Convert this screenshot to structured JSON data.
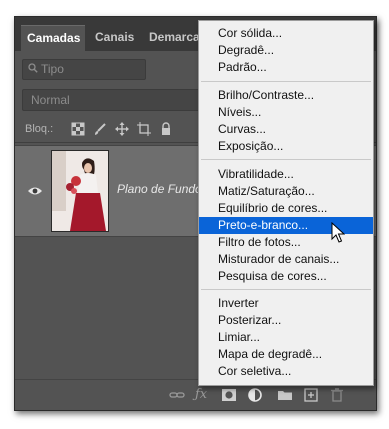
{
  "tabs": [
    {
      "label": "Camadas",
      "active": true
    },
    {
      "label": "Canais",
      "active": false
    },
    {
      "label": "Demarcadores",
      "active": false
    }
  ],
  "search": {
    "value": "Tipo",
    "icon": "search-icon"
  },
  "blend_mode": {
    "value": "Normal"
  },
  "lock": {
    "label": "Bloq.:"
  },
  "layer": {
    "name": "Plano de Fundo",
    "visible": true
  },
  "menu": {
    "groups": [
      [
        "Cor sólida...",
        "Degradê...",
        "Padrão..."
      ],
      [
        "Brilho/Contraste...",
        "Níveis...",
        "Curvas...",
        "Exposição..."
      ],
      [
        "Vibratilidade...",
        "Matiz/Saturação...",
        "Equilíbrio de cores...",
        "Preto-e-branco...",
        "Filtro de fotos...",
        "Misturador de canais...",
        "Pesquisa de cores..."
      ],
      [
        "Inverter",
        "Posterizar...",
        "Limiar...",
        "Mapa de degradê...",
        "Cor seletiva..."
      ]
    ],
    "highlighted": "Preto-e-branco..."
  },
  "colors": {
    "panel_bg": "#535353",
    "tabbar_bg": "#393939",
    "layer_selected_bg": "#6e6e6e",
    "menu_bg": "#f0f0f0",
    "highlight": "#0a64d8"
  }
}
